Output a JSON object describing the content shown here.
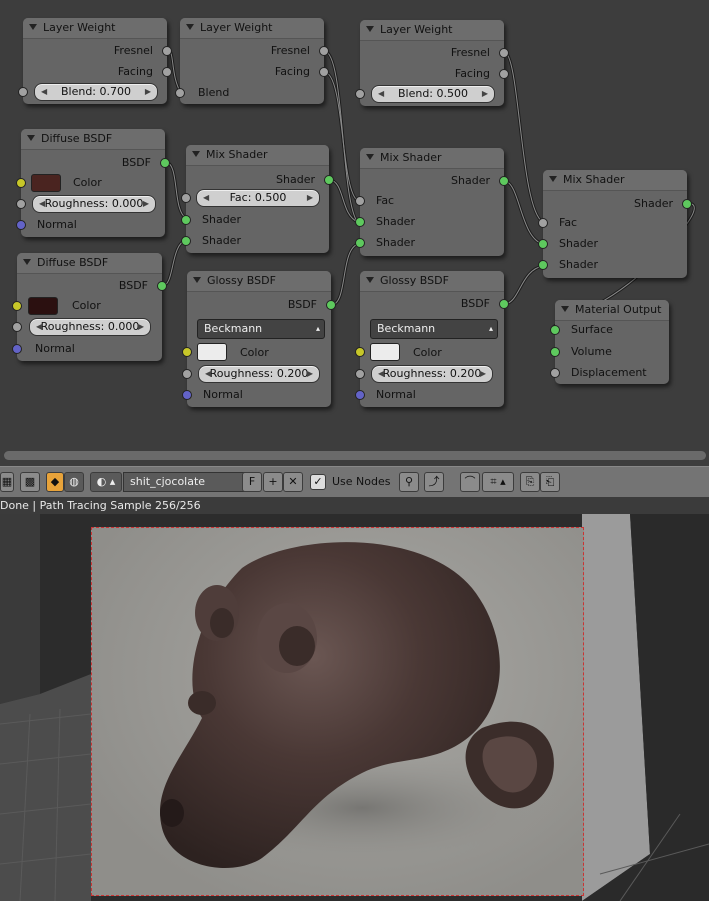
{
  "nodes": {
    "lw1": {
      "title": "Layer Weight",
      "outputs": [
        "Fresnel",
        "Facing"
      ],
      "blend": "Blend: 0.700"
    },
    "lw2": {
      "title": "Layer Weight",
      "outputs": [
        "Fresnel",
        "Facing"
      ],
      "input": "Blend"
    },
    "lw3": {
      "title": "Layer Weight",
      "outputs": [
        "Fresnel",
        "Facing"
      ],
      "blend": "Blend: 0.500"
    },
    "diff1": {
      "title": "Diffuse BSDF",
      "output": "BSDF",
      "color_label": "Color",
      "color": "#4a2420",
      "roughness": "Roughness: 0.000",
      "normal": "Normal"
    },
    "diff2": {
      "title": "Diffuse BSDF",
      "output": "BSDF",
      "color_label": "Color",
      "color": "#2b1010",
      "roughness": "Roughness: 0.000",
      "normal": "Normal"
    },
    "mix1": {
      "title": "Mix Shader",
      "output": "Shader",
      "fac": "Fac: 0.500",
      "inputs": [
        "Shader",
        "Shader"
      ]
    },
    "mix2": {
      "title": "Mix Shader",
      "output": "Shader",
      "inputs": [
        "Fac",
        "Shader",
        "Shader"
      ]
    },
    "mix3": {
      "title": "Mix Shader",
      "output": "Shader",
      "inputs": [
        "Fac",
        "Shader",
        "Shader"
      ]
    },
    "gloss1": {
      "title": "Glossy BSDF",
      "output": "BSDF",
      "distribution": "Beckmann",
      "color_label": "Color",
      "color": "#ececec",
      "roughness": "Roughness: 0.200",
      "normal": "Normal"
    },
    "gloss2": {
      "title": "Glossy BSDF",
      "output": "BSDF",
      "distribution": "Beckmann",
      "color_label": "Color",
      "color": "#ececec",
      "roughness": "Roughness: 0.200",
      "normal": "Normal"
    },
    "out": {
      "title": "Material Output",
      "inputs": [
        "Surface",
        "Volume",
        "Displacement"
      ]
    }
  },
  "toolbar": {
    "material_name": "shit_cjocolate",
    "fake_user": "F",
    "add": "+",
    "remove": "✕",
    "use_nodes_label": "Use Nodes",
    "use_nodes_checked": "✓"
  },
  "status": "Done | Path Tracing Sample 256/256",
  "colors": {
    "socket_shader": "#5ec95e",
    "socket_color": "#c7c729",
    "socket_vector": "#6363c7",
    "socket_float": "#a1a1a1",
    "render_border": "#cc3333"
  }
}
